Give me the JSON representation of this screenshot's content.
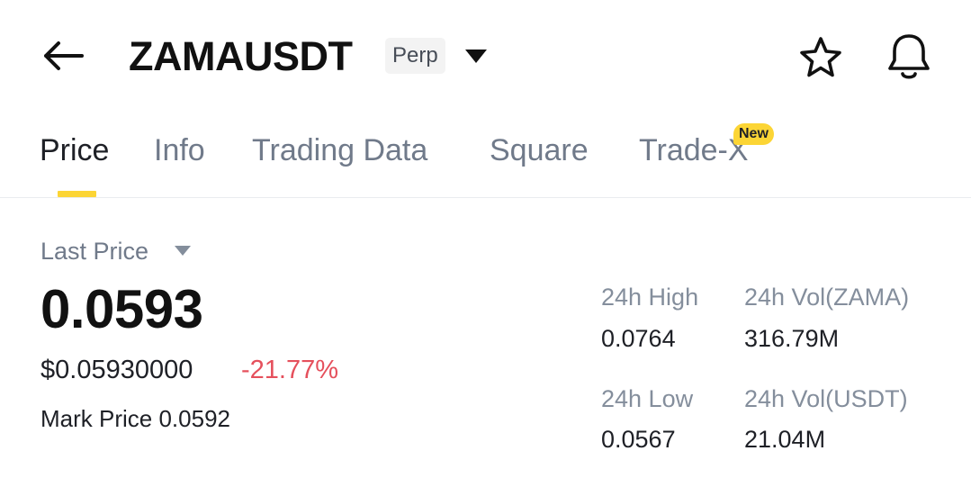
{
  "header": {
    "symbol": "ZAMAUSDT",
    "badge": "Perp",
    "icons": [
      "back-arrow-icon",
      "caret-down-icon",
      "star-icon",
      "bell-icon"
    ]
  },
  "tabs": [
    {
      "label": "Price",
      "active": true
    },
    {
      "label": "Info",
      "active": false
    },
    {
      "label": "Trading Data",
      "active": false
    },
    {
      "label": "Square",
      "active": false
    },
    {
      "label": "Trade-X",
      "active": false,
      "badge": "New"
    }
  ],
  "price": {
    "label": "Last Price",
    "value": "0.0593",
    "usd": "$0.05930000",
    "change": "-21.77%",
    "mark_label": "Mark Price 0.0592"
  },
  "stats": {
    "high_label": "24h High",
    "high_value": "0.0764",
    "vol_zama_label": "24h Vol(ZAMA)",
    "vol_zama_value": "316.79M",
    "low_label": "24h Low",
    "low_value": "0.0567",
    "vol_usdt_label": "24h Vol(USDT)",
    "vol_usdt_value": "21.04M"
  },
  "colors": {
    "accent": "#fcd535",
    "negative": "#e5505c",
    "muted": "#707a8a",
    "text": "#1e2026"
  }
}
